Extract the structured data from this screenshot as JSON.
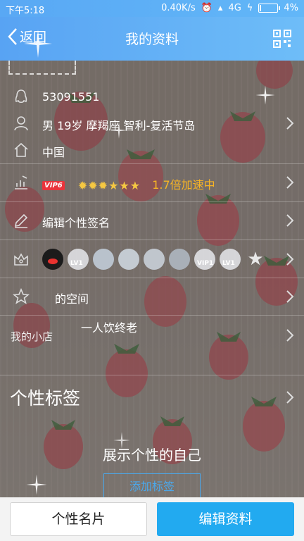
{
  "status_bar": {
    "time": "下午5:18",
    "network_speed": "0.40K/s",
    "signal": "4G",
    "battery": "4%"
  },
  "header": {
    "back_label": "返回",
    "title": "我的资料"
  },
  "profile": {
    "qq_number": "53091551",
    "info": "男  19岁  摩羯座  智利-复活节岛",
    "location": "中国",
    "vip_badge": "VIP6",
    "speed_text": "1.7倍加速中",
    "signature_label": "编辑个性签名",
    "space_label": "的空间",
    "shop_label": "我的小店",
    "shop_value": "一人饮终老"
  },
  "badges": {
    "lv_label": "LV1",
    "vip_label": "VIP1"
  },
  "tags": {
    "section_title": "个性标签",
    "empty_text": "展示个性的自己",
    "add_button": "添加标签"
  },
  "footer": {
    "card_button": "个性名片",
    "edit_button": "编辑资料"
  },
  "colors": {
    "header_blue": "#5aa8f5",
    "accent_blue": "#22aaf0",
    "speed_orange": "#f7b425",
    "vip_red": "#e9343c"
  }
}
